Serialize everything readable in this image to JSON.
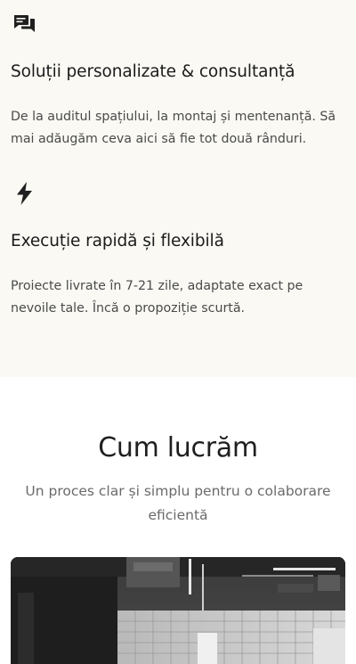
{
  "features": [
    {
      "icon": "chat-icon",
      "title": "Soluții personalizate & consultanță",
      "description": "De la auditul spațiului, la montaj și mentenanță. Să mai adăugăm ceva aici să fie tot două rânduri."
    },
    {
      "icon": "lightning-icon",
      "title": "Execuție rapidă și flexibilă",
      "description": "Proiecte livrate în 7-21 zile, adaptate exact pe nevoile tale. Încă o propoziție scurtă."
    }
  ],
  "how_we_work": {
    "title": "Cum lucrăm",
    "subtitle": "Un proces clar și simplu pentru o colaborare eficientă"
  },
  "colors": {
    "features_background": "#faf9f4",
    "text_dark": "#1b1b1b",
    "text_muted": "#6a6a6a"
  }
}
